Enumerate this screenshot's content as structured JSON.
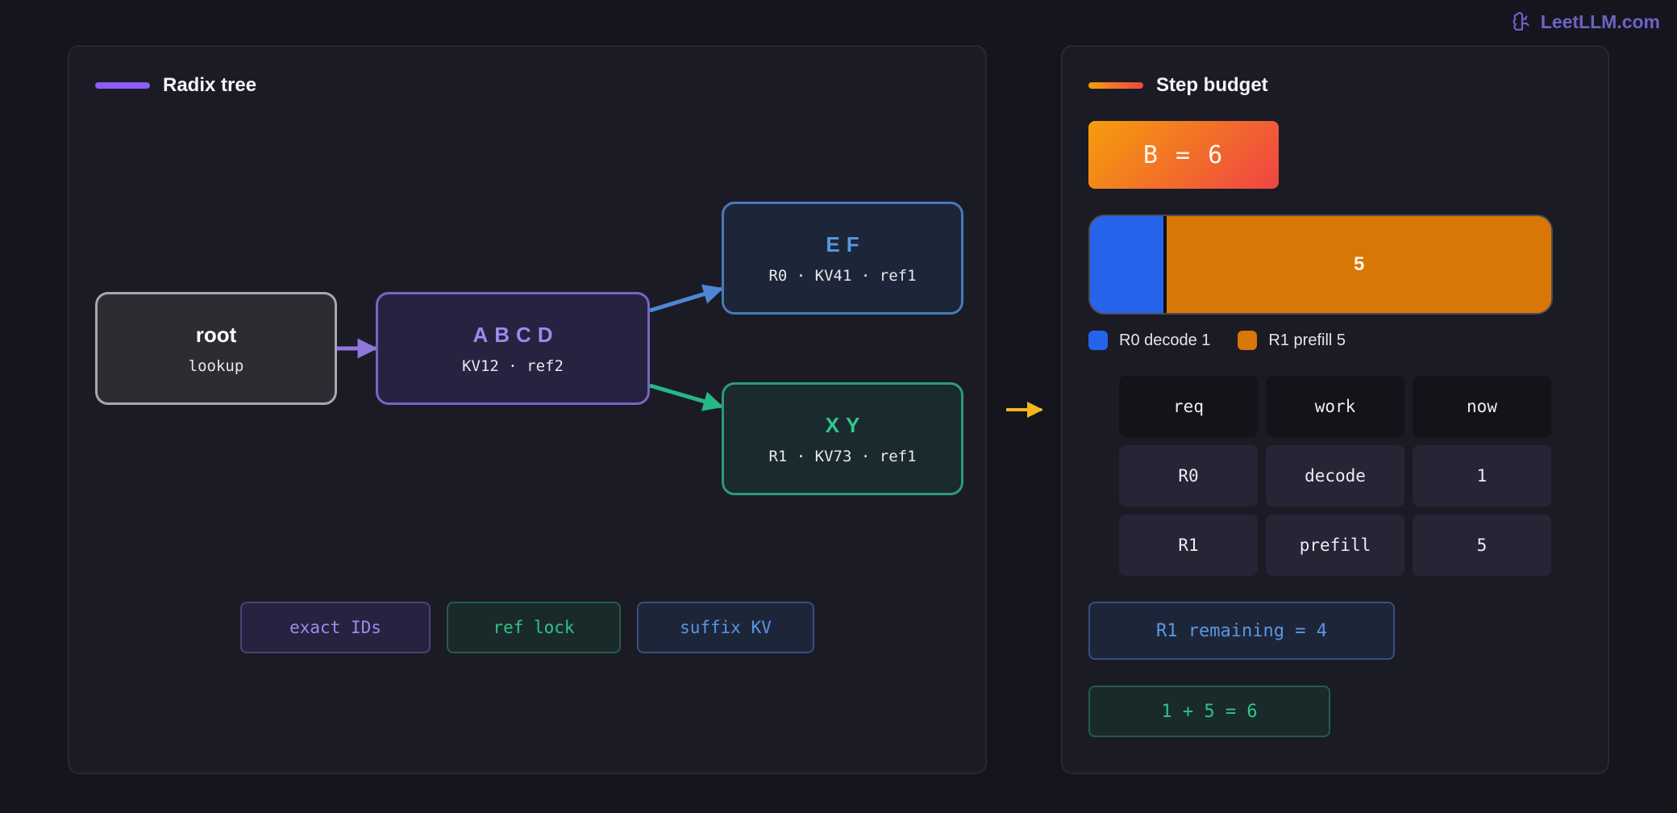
{
  "brand": {
    "name": "LeetLLM.com",
    "icon": "brain-icon",
    "color": "#6f62c4"
  },
  "tree_panel": {
    "title": "Radix tree",
    "accent": "#8b5cf6",
    "nodes": {
      "root": {
        "title": "root",
        "sub": "lookup"
      },
      "abcd": {
        "title": "ABCD",
        "sub": "KV12 · ref2"
      },
      "ef": {
        "title": "EF",
        "sub": "R0 · KV41 · ref1"
      },
      "xy": {
        "title": "XY",
        "sub": "R1 · KV73 · ref1"
      }
    },
    "chips": [
      "exact IDs",
      "ref lock",
      "suffix KV"
    ]
  },
  "budget_panel": {
    "title": "Step budget",
    "accent": "#f97316",
    "budget_label": "B = 6",
    "bar": {
      "total": 6,
      "segments": [
        {
          "name": "R0 decode",
          "value": 1,
          "color": "#2563eb",
          "label": ""
        },
        {
          "name": "R1 prefill",
          "value": 5,
          "color": "#d97706",
          "label": "5"
        }
      ]
    },
    "legend": [
      "R0 decode 1",
      "R1 prefill 5"
    ],
    "table": {
      "headers": [
        "req",
        "work",
        "now"
      ],
      "rows": [
        [
          "R0",
          "decode",
          "1"
        ],
        [
          "R1",
          "prefill",
          "5"
        ]
      ]
    },
    "remaining": "R1 remaining = 4",
    "sum": "1 + 5 = 6"
  }
}
